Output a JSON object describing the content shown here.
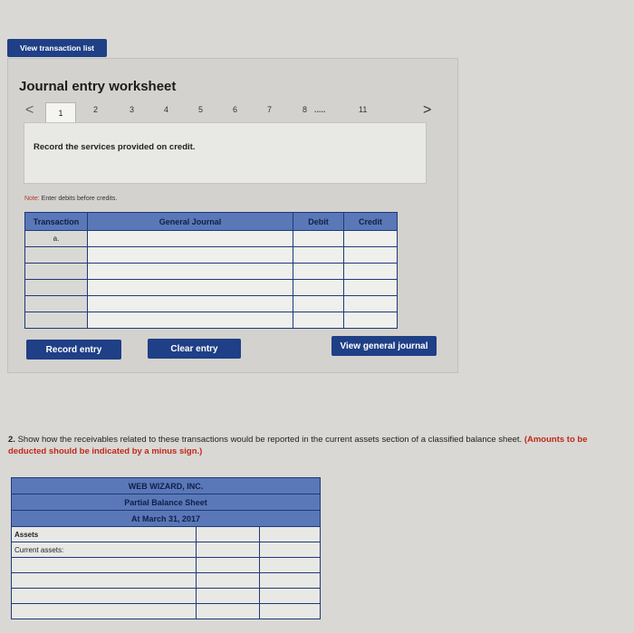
{
  "top_button": {
    "label": "View transaction list"
  },
  "worksheet": {
    "title": "Journal entry worksheet",
    "pager": {
      "prev": "<",
      "next": ">",
      "pages": [
        "1",
        "2",
        "3",
        "4",
        "5",
        "6",
        "7",
        "8",
        "11"
      ],
      "ellipsis": "....."
    },
    "prompt": "Record the services provided on credit.",
    "note_label": "Note:",
    "note_text": " Enter debits before credits.",
    "table": {
      "headers": [
        "Transaction",
        "General Journal",
        "Debit",
        "Credit"
      ],
      "rows": [
        [
          "a.",
          "",
          "",
          ""
        ],
        [
          "",
          "",
          "",
          ""
        ],
        [
          "",
          "",
          "",
          ""
        ],
        [
          "",
          "",
          "",
          ""
        ],
        [
          "",
          "",
          "",
          ""
        ],
        [
          "",
          "",
          "",
          ""
        ]
      ]
    },
    "buttons": {
      "record": "Record entry",
      "clear": "Clear entry",
      "view_journal": "View general journal"
    }
  },
  "question2": {
    "number": "2.",
    "text": " Show how the receivables related to these transactions would be reported in the current assets section of a classified balance sheet.",
    "instruction": " (Amounts to be deducted should be indicated by a minus sign.)"
  },
  "balance_sheet": {
    "company": "WEB WIZARD, INC.",
    "title": "Partial Balance Sheet",
    "date": "At March 31, 2017",
    "assets_label": "Assets",
    "current_assets_label": "Current assets:"
  }
}
